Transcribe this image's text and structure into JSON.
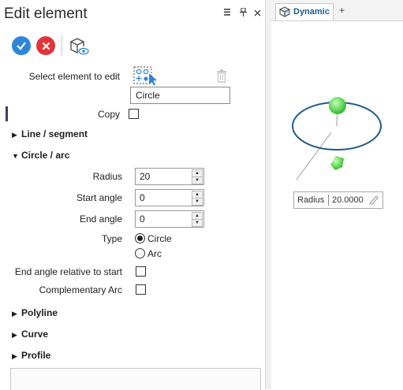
{
  "panel": {
    "title": "Edit element",
    "header_icons": [
      "list-icon",
      "pin-icon",
      "close-icon"
    ],
    "toolbar": {
      "ok_icon": "check-icon",
      "cancel_icon": "x-icon",
      "view_icon": "cube-view-icon"
    },
    "select_label": "Select element to edit",
    "element_name": "Circle",
    "copy_label": "Copy",
    "sections": {
      "line": "Line / segment",
      "circle": "Circle / arc",
      "polyline": "Polyline",
      "curve": "Curve",
      "profile": "Profile"
    },
    "radius_label": "Radius",
    "radius_value": "20",
    "start_angle_label": "Start angle",
    "start_angle_value": "0",
    "end_angle_label": "End angle",
    "end_angle_value": "0",
    "type_label": "Type",
    "type_options": [
      "Circle",
      "Arc"
    ],
    "type_selected": "Circle",
    "end_rel_label": "End angle relative to start",
    "compl_label": "Complementary Arc"
  },
  "view": {
    "tab_label": "Dynamic",
    "add_tab": "+",
    "radius_tag": "Radius",
    "radius_tag_value": "20.0000",
    "accent_color": "#1f5b8a"
  }
}
